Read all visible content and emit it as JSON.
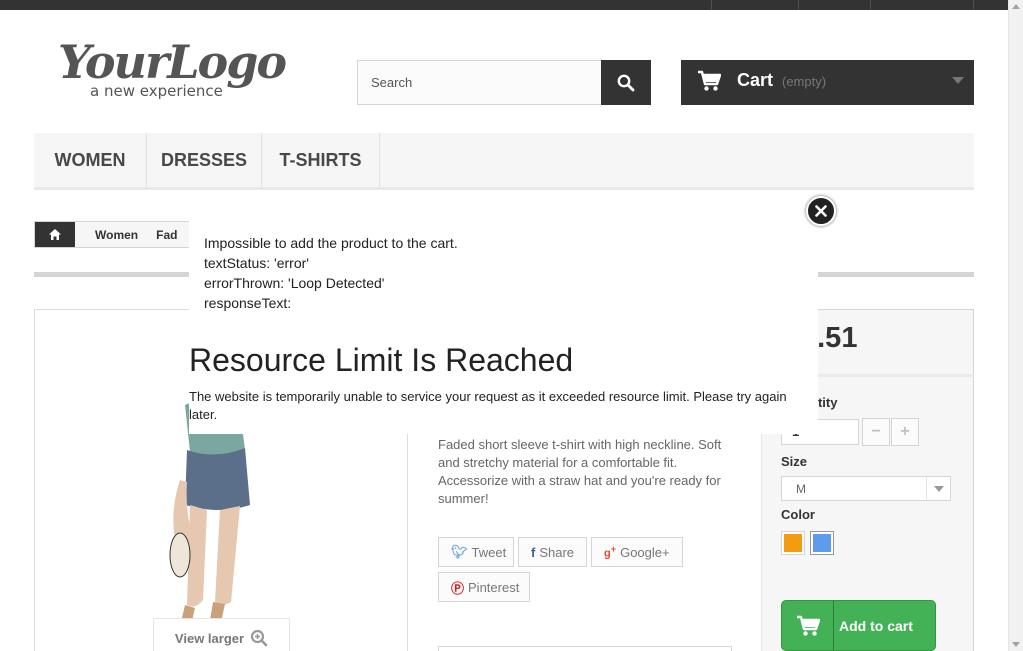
{
  "header": {
    "logo": {
      "main": "YourLogo",
      "tagline": "a new experience"
    },
    "search": {
      "placeholder": "Search"
    },
    "cart": {
      "label": "Cart",
      "status": "(empty)"
    }
  },
  "menu": {
    "items": [
      {
        "label": "Women"
      },
      {
        "label": "Dresses"
      },
      {
        "label": "T-shirts"
      }
    ]
  },
  "breadcrumb": {
    "items": [
      "Women",
      "Fad"
    ]
  },
  "product": {
    "price_visible": "6.51",
    "description": "Faded short sleeve t-shirt with high neckline. Soft and stretchy material for a comfortable fit. Accessorize with a straw hat and you're ready for summer!",
    "view_larger": "View larger",
    "social": {
      "tweet": "Tweet",
      "share": "Share",
      "google": "Google+",
      "pinterest": "Pinterest"
    },
    "quantity_label": "ntity",
    "quantity_value": "1",
    "size_label": "Size",
    "size_value": "M",
    "color_label": "Color",
    "colors": [
      "#F39C11",
      "#5D9CEC"
    ],
    "add_to_cart": "Add to cart"
  },
  "modal": {
    "line1": "Impossible to add the product to the cart.",
    "line2": "textStatus: 'error'",
    "line3": "errorThrown: 'Loop Detected'",
    "line4": "responseText:",
    "heading": "Resource Limit Is Reached",
    "note": "The website is temporarily unable to service your request as it exceeded resource limit. Please try again later."
  }
}
